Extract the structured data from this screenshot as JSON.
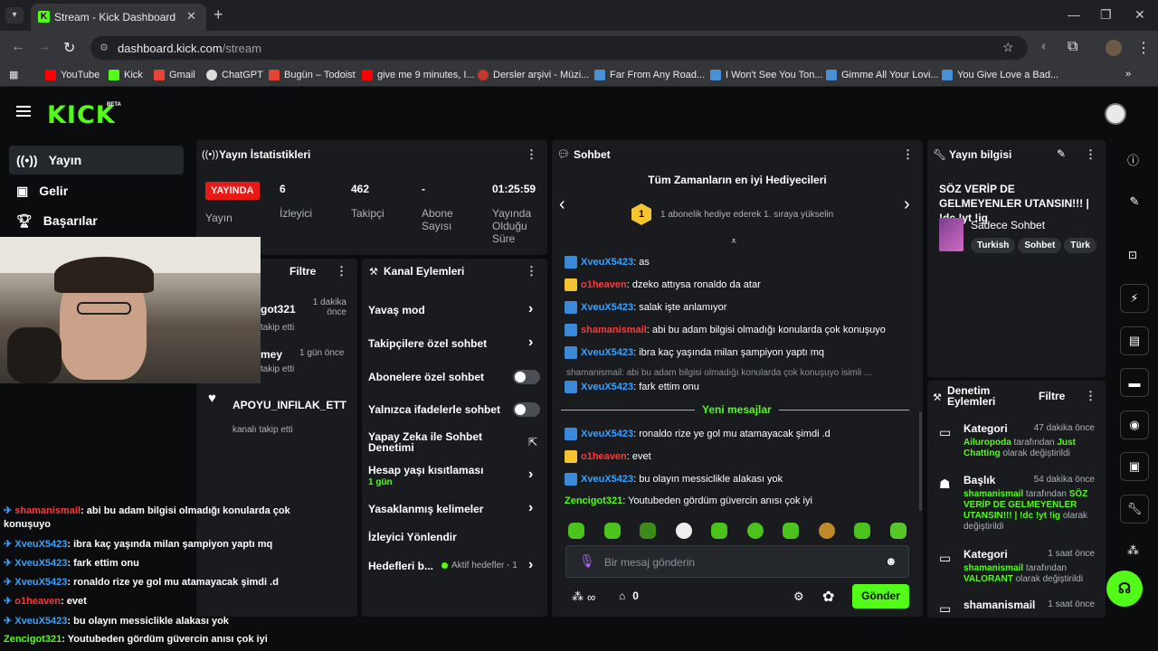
{
  "browser": {
    "tab_title": "Stream - Kick Dashboard",
    "url_host": "dashboard.kick.com",
    "url_path": "/stream",
    "bookmarks": [
      "YouTube",
      "Kick",
      "Gmail",
      "ChatGPT",
      "Bugün – Todoist",
      "give me 9 minutes, I...",
      "Dersler arşivi - Müzi...",
      "Far From Any Road...",
      "I Won't See You Ton...",
      "Gimme All Your Lovi...",
      "You Give Love a Bad..."
    ]
  },
  "app": {
    "logo": "KICK",
    "beta": "BETA"
  },
  "sidenav": {
    "items": [
      "Yayın",
      "Gelir",
      "Başarılar"
    ]
  },
  "stats": {
    "title": "Yayın İstatistikleri",
    "live_badge": "YAYINDA",
    "stream_label": "Yayın",
    "viewers_value": "6",
    "viewers_label": "İzleyici",
    "followers_value": "462",
    "followers_label": "Takipçi",
    "subs_value": "-",
    "subs_label": "Abone Sayısı",
    "duration_value": "01:25:59",
    "duration_label": "Yayında Olduğu Süre"
  },
  "activity": {
    "filter": "Filtre",
    "items": [
      {
        "name": "got321",
        "sub": "takip etti",
        "time": "1 dakika önce"
      },
      {
        "name": "mey",
        "sub": "takip etti",
        "time": "1 gün önce"
      },
      {
        "name": "APOYU_INFILAK_ETTI",
        "sub": "kanalı takip etti",
        "time": ""
      }
    ]
  },
  "channel_actions": {
    "title": "Kanal Eylemleri",
    "slow_mode": "Yavaş mod",
    "followers_only": "Takipçilere özel sohbet",
    "subs_only": "Abonelere özel sohbet",
    "emotes_only": "Yalnızca ifadelerle sohbet",
    "ai_moderation": "Yapay Zeka ile Sohbet Denetimi",
    "account_age": "Hesap yaşı kısıtlaması",
    "account_age_value": "1 gün",
    "banned_words": "Yasaklanmış kelimeler",
    "host": "İzleyici Yönlendir",
    "goals": "Hedefleri b...",
    "goals_status": "Aktif hedefler - 1"
  },
  "chat": {
    "title": "Sohbet",
    "gifters_title": "Tüm Zamanların en iyi Hediyecileri",
    "gifters_rank": "1",
    "gifters_text": "1 abonelik hediye ederek 1. sıraya yükselin",
    "messages_top": [
      {
        "user": "XveuX5423",
        "color": "blue",
        "badge": "b",
        "text": ": as"
      },
      {
        "user": "o1heaven",
        "color": "red",
        "badge": "c",
        "text": ": dzeko attıysa ronaldo da atar"
      },
      {
        "user": "XveuX5423",
        "color": "blue",
        "badge": "b",
        "text": ": salak işte anlamıyor"
      },
      {
        "user": "shamanismail",
        "color": "red",
        "badge": "b",
        "text": ": abi bu adam bilgisi olmadığı konularda çok konuşuyo"
      },
      {
        "user": "XveuX5423",
        "color": "blue",
        "badge": "b",
        "text": ": ibra kaç yaşında milan şampiyon yaptı mq"
      }
    ],
    "reply_preview": "shamanismail: abi bu adam bilgisi olmadığı konularda çok konuşuyo isimli ...",
    "reply_msg": {
      "user": "XveuX5423",
      "text": ": fark ettim onu"
    },
    "new_messages": "Yeni mesajlar",
    "messages_new": [
      {
        "user": "XveuX5423",
        "color": "blue",
        "badge": "b",
        "text": ": ronaldo rize ye gol mu atamayacak şimdi .d"
      },
      {
        "user": "o1heaven",
        "color": "red",
        "badge": "c",
        "text": ": evet"
      },
      {
        "user": "XveuX5423",
        "color": "blue",
        "badge": "b",
        "text": ": bu olayın messiclikle alakası yok"
      },
      {
        "user": "Zencigot321",
        "color": "green",
        "badge": "",
        "text": ": Youtubeden gördüm güvercin anısı çok iyi"
      }
    ],
    "input_placeholder": "Bir mesaj gönderin",
    "points": "∞",
    "gifts": "0",
    "send": "Gönder"
  },
  "stream_info": {
    "title": "Yayın bilgisi",
    "stream_title": "SÖZ VERİP DE GELMEYENLER UTANSIN!!! | !dc !yt !ig",
    "category": "Sadece Sohbet",
    "tags": [
      "Turkish",
      "Sohbet",
      "Türk"
    ]
  },
  "mod": {
    "title": "Denetim Eylemleri",
    "filter": "Filtre",
    "items": [
      {
        "kind": "Kategori",
        "time": "47 dakika önce",
        "user": "Ailuropoda",
        "mid": " tarafından ",
        "target": "Just Chatting",
        "end": " olarak değiştirildi"
      },
      {
        "kind": "Başlık",
        "time": "54 dakika önce",
        "user": "shamanismail",
        "mid": " tarafından ",
        "target": "SÖZ VERİP DE GELMEYENLER UTANSIN!!! | !dc !yt !ig",
        "end": " olarak değiştirildi"
      },
      {
        "kind": "Kategori",
        "time": "1 saat önce",
        "user": "shamanismail",
        "mid": " tarafından ",
        "target": "VALORANT",
        "end": " olarak değiştirildi"
      },
      {
        "kind": "shamanismail",
        "time": "1 saat önce",
        "user": "",
        "mid": "",
        "target": "",
        "end": ""
      }
    ]
  },
  "overlay": {
    "lines": [
      {
        "user": "shamanismail",
        "color": "red",
        "text": ": abi bu adam bilgisi olmadığı konularda çok"
      },
      {
        "user": "",
        "color": "",
        "text": "konuşuyo"
      },
      {
        "user": "XveuX5423",
        "color": "blue",
        "text": ": ibra kaç yaşında milan şampiyon yaptı mq"
      },
      {
        "user": "XveuX5423",
        "color": "blue",
        "text": ": fark ettim onu"
      },
      {
        "user": "XveuX5423",
        "color": "blue",
        "text": ": ronaldo rize ye gol mu atamayacak şimdi .d"
      },
      {
        "user": "o1heaven",
        "color": "red",
        "text": ": evet"
      },
      {
        "user": "XveuX5423",
        "color": "blue",
        "text": ": bu olayın messiclikle alakası yok"
      },
      {
        "user": "Zencigot321",
        "color": "green",
        "text": ": Youtubeden gördüm güvercin anısı çok iyi"
      }
    ]
  },
  "colors": {
    "brand": "#53fc18",
    "live": "#e91916",
    "panel": "#191b1f",
    "bg": "#0b0c0d"
  }
}
